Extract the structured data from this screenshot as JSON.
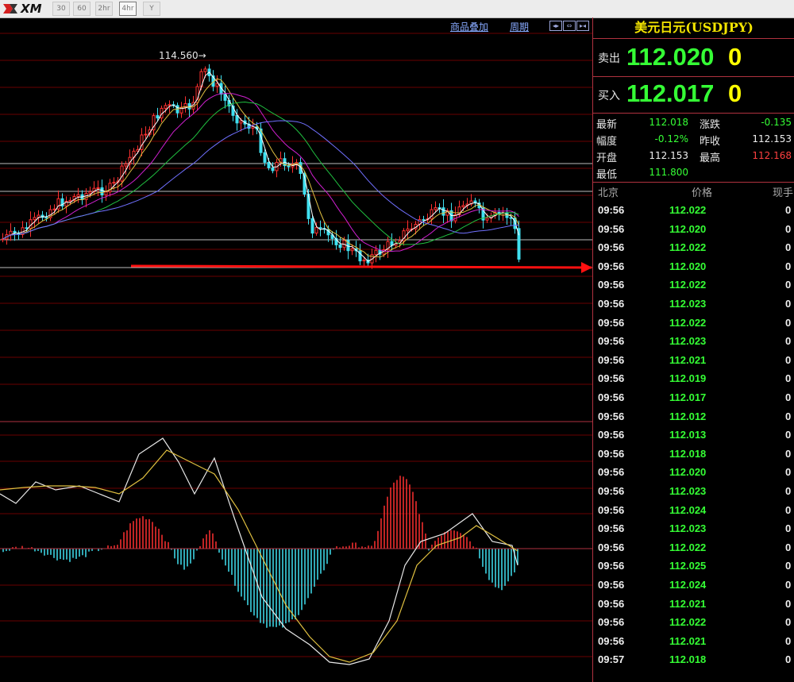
{
  "toolbar": {
    "logo": "XM",
    "buttons": [
      {
        "label": "30",
        "active": false
      },
      {
        "label": "60",
        "active": false
      },
      {
        "label": "2hr",
        "active": false
      },
      {
        "label": "4hr",
        "active": true
      },
      {
        "label": "Y",
        "active": false
      }
    ]
  },
  "chart": {
    "links": {
      "overlay": "商品叠加",
      "period": "周期"
    },
    "high_label": "114.560",
    "colors": {
      "up": "#ff3030",
      "down": "#40e0f0",
      "grid": "#6a0000",
      "ma5": "#ffffff",
      "ma10": "#e0c040",
      "ma20": "#d020d0",
      "ma40": "#20c040",
      "ma60": "#7070ff",
      "hline": "#bbbbbb",
      "arrow": "#ff1010"
    }
  },
  "panel": {
    "title": "美元日元(USDJPY)",
    "sell": {
      "label": "卖出",
      "price": "112.020",
      "vol": "0"
    },
    "buy": {
      "label": "买入",
      "price": "112.017",
      "vol": "0"
    },
    "stats": [
      {
        "label": "最新",
        "value": "112.018",
        "color": "#35ff35"
      },
      {
        "label": "涨跌",
        "value": "-0.135",
        "color": "#35ff35"
      },
      {
        "label": "幅度",
        "value": "-0.12%",
        "color": "#35ff35"
      },
      {
        "label": "昨收",
        "value": "112.153",
        "color": "#f0f0f0"
      },
      {
        "label": "开盘",
        "value": "112.153",
        "color": "#f0f0f0"
      },
      {
        "label": "最高",
        "value": "112.168",
        "color": "#ff4040"
      },
      {
        "label": "最低",
        "value": "111.800",
        "color": "#35ff35"
      }
    ],
    "tick_headers": {
      "time": "北京",
      "price": "价格",
      "vol": "现手"
    },
    "ticks": [
      {
        "time": "09:56",
        "price": "112.022",
        "vol": "0"
      },
      {
        "time": "09:56",
        "price": "112.020",
        "vol": "0"
      },
      {
        "time": "09:56",
        "price": "112.022",
        "vol": "0"
      },
      {
        "time": "09:56",
        "price": "112.020",
        "vol": "0"
      },
      {
        "time": "09:56",
        "price": "112.022",
        "vol": "0"
      },
      {
        "time": "09:56",
        "price": "112.023",
        "vol": "0"
      },
      {
        "time": "09:56",
        "price": "112.022",
        "vol": "0"
      },
      {
        "time": "09:56",
        "price": "112.023",
        "vol": "0"
      },
      {
        "time": "09:56",
        "price": "112.021",
        "vol": "0"
      },
      {
        "time": "09:56",
        "price": "112.019",
        "vol": "0"
      },
      {
        "time": "09:56",
        "price": "112.017",
        "vol": "0"
      },
      {
        "time": "09:56",
        "price": "112.012",
        "vol": "0"
      },
      {
        "time": "09:56",
        "price": "112.013",
        "vol": "0"
      },
      {
        "time": "09:56",
        "price": "112.018",
        "vol": "0"
      },
      {
        "time": "09:56",
        "price": "112.020",
        "vol": "0"
      },
      {
        "time": "09:56",
        "price": "112.023",
        "vol": "0"
      },
      {
        "time": "09:56",
        "price": "112.024",
        "vol": "0"
      },
      {
        "time": "09:56",
        "price": "112.023",
        "vol": "0"
      },
      {
        "time": "09:56",
        "price": "112.022",
        "vol": "0"
      },
      {
        "time": "09:56",
        "price": "112.025",
        "vol": "0"
      },
      {
        "time": "09:56",
        "price": "112.024",
        "vol": "0"
      },
      {
        "time": "09:56",
        "price": "112.021",
        "vol": "0"
      },
      {
        "time": "09:56",
        "price": "112.022",
        "vol": "0"
      },
      {
        "time": "09:56",
        "price": "112.021",
        "vol": "0"
      },
      {
        "time": "09:57",
        "price": "112.018",
        "vol": "0"
      }
    ]
  }
}
